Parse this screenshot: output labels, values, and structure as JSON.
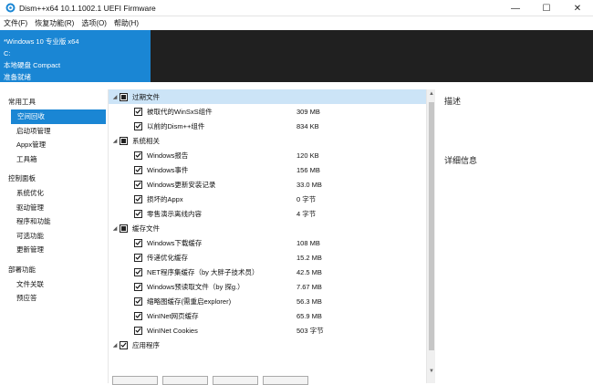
{
  "window": {
    "title": "Dism++x64 10.1.1002.1 UEFI Firmware",
    "min_glyph": "—",
    "max_glyph": "☐",
    "close_glyph": "✕"
  },
  "menu": [
    "文件(F)",
    "恢复功能(R)",
    "选项(O)",
    "帮助(H)"
  ],
  "image_panel": {
    "name": "*Windows 10 专业版 x64",
    "drive": "C:",
    "disk_type": "本地硬盘 Compact",
    "status": "准备就绪"
  },
  "sidebar": {
    "sections": [
      {
        "title": "常用工具",
        "items": [
          "空间回收",
          "启动项管理",
          "Appx管理",
          "工具箱"
        ]
      },
      {
        "title": "控制面板",
        "items": [
          "系统优化",
          "驱动管理",
          "程序和功能",
          "可选功能",
          "更新管理"
        ]
      },
      {
        "title": "部署功能",
        "items": [
          "文件关联",
          "预应答"
        ]
      }
    ],
    "active": "空间回收"
  },
  "cleanup": {
    "groups": [
      {
        "title": "过期文件",
        "state": "partial",
        "selected": true,
        "items": [
          {
            "label": "被取代的WinSxS组件",
            "size": "309 MB",
            "checked": true
          },
          {
            "label": "以前的Dism++组件",
            "size": "834 KB",
            "checked": true
          }
        ]
      },
      {
        "title": "系统相关",
        "state": "partial",
        "selected": false,
        "items": [
          {
            "label": "Windows报告",
            "size": "120 KB",
            "checked": true
          },
          {
            "label": "Windows事件",
            "size": "156 MB",
            "checked": true
          },
          {
            "label": "Windows更新安装记录",
            "size": "33.0 MB",
            "checked": true
          },
          {
            "label": "损坏的Appx",
            "size": "0 字节",
            "checked": true
          },
          {
            "label": "零售演示离线内容",
            "size": "4 字节",
            "checked": true
          }
        ]
      },
      {
        "title": "缓存文件",
        "state": "partial",
        "selected": false,
        "items": [
          {
            "label": "Windows下载缓存",
            "size": "108 MB",
            "checked": true
          },
          {
            "label": "传递优化缓存",
            "size": "15.2 MB",
            "checked": true
          },
          {
            "label": "NET程序集缓存（by 大胖子技术员）",
            "size": "42.5 MB",
            "checked": true
          },
          {
            "label": "Windows预读取文件（by 探g.）",
            "size": "7.67 MB",
            "checked": true
          },
          {
            "label": "缩略图缓存(需重启explorer)",
            "size": "56.3 MB",
            "checked": true
          },
          {
            "label": "WinINet网页缓存",
            "size": "65.9 MB",
            "checked": true
          },
          {
            "label": "WinINet Cookies",
            "size": "503 字节",
            "checked": true
          }
        ]
      },
      {
        "title": "应用程序",
        "state": "checked",
        "selected": false,
        "items": []
      }
    ]
  },
  "right_panel": {
    "description_title": "描述",
    "details_title": "详细信息"
  },
  "icons": {
    "app": "dism-gear-icon",
    "expand": "triangle-down-icon"
  },
  "colors": {
    "accent": "#1a86d4",
    "header_dark": "#202020",
    "selection": "#cce4f7"
  }
}
